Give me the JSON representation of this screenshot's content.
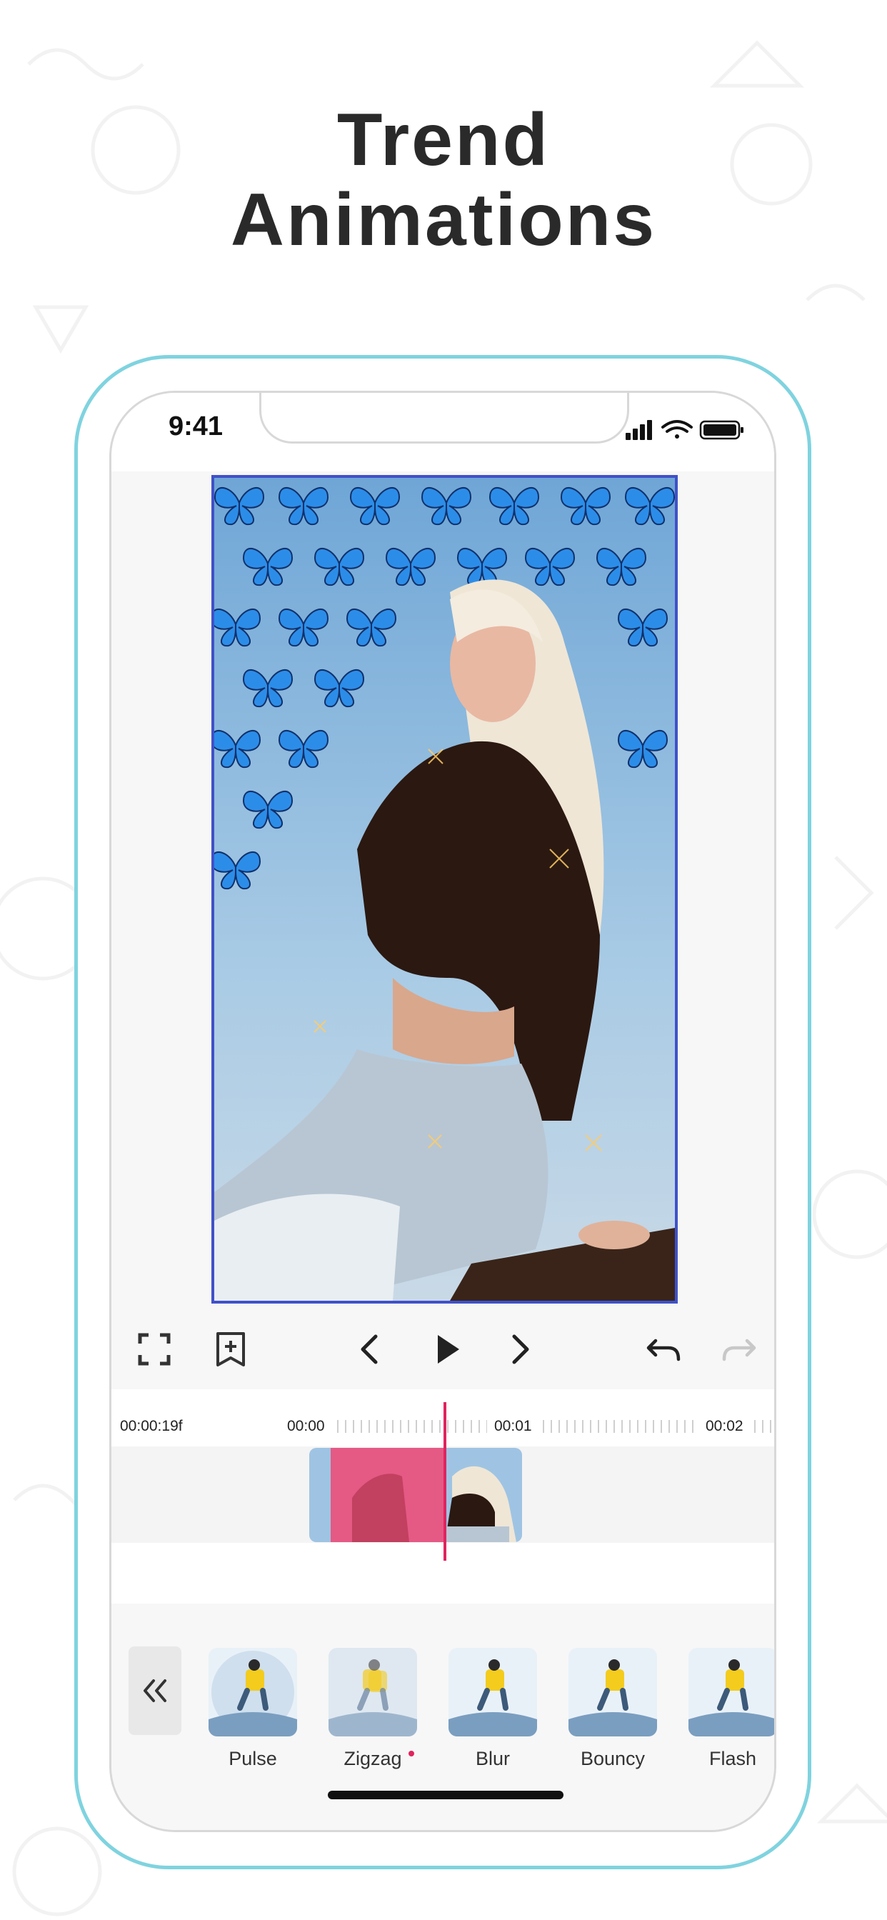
{
  "headline": {
    "line1": "Trend",
    "line2": "Animations"
  },
  "status_bar": {
    "time": "9:41",
    "icons": [
      "signal-icon",
      "wifi-icon",
      "battery-icon"
    ]
  },
  "toolbar": {
    "icons": [
      "fullscreen-icon",
      "add-bookmark-icon",
      "previous-icon",
      "play-icon",
      "next-icon",
      "undo-icon",
      "redo-icon"
    ]
  },
  "timeline": {
    "current_time": "00:00:19f",
    "marks": [
      "00:00",
      "00:01",
      "00:02"
    ]
  },
  "animations": {
    "items": [
      {
        "label": "Pulse",
        "new": false
      },
      {
        "label": "Zigzag",
        "new": true
      },
      {
        "label": "Blur",
        "new": false
      },
      {
        "label": "Bouncy",
        "new": false
      },
      {
        "label": "Flash",
        "new": false
      }
    ]
  },
  "colors": {
    "accent": "#e0245e",
    "phone_border": "#7fd3df",
    "preview_border": "#3f51c8"
  }
}
